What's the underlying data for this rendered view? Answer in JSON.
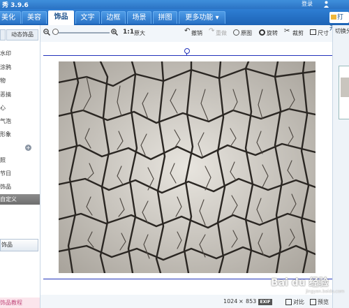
{
  "app": {
    "title": "秀 3.9.6",
    "login": "登录"
  },
  "tabs": [
    {
      "label": "美化",
      "active": false
    },
    {
      "label": "美容",
      "active": false
    },
    {
      "label": "饰品",
      "active": true
    },
    {
      "label": "文字",
      "active": false
    },
    {
      "label": "边框",
      "active": false
    },
    {
      "label": "场景",
      "active": false
    },
    {
      "label": "拼图",
      "active": false
    },
    {
      "label": "更多功能 ▾",
      "active": false
    }
  ],
  "open_button": "打开",
  "sidebar": {
    "dynamic_label": "动态饰品",
    "items": [
      "水印",
      "涂鸦",
      "物",
      "恶搞",
      "心",
      "气泡",
      "形象",
      "",
      "照",
      "节日",
      "饰品",
      "自定义"
    ],
    "selected_index": 11,
    "button_label": "饰品",
    "bottom_label": "饰品教程"
  },
  "toolbar": {
    "zoom_ratio": "1:1",
    "original_size": "原大",
    "undo": "撤销",
    "redo": "重做",
    "original_image": "原图",
    "rotate": "旋转",
    "crop": "裁剪",
    "size": "尺寸"
  },
  "right_panel": {
    "title": "切换分"
  },
  "status": {
    "width": "1024",
    "times": "×",
    "height": "853",
    "exif": "EXIF",
    "compare": "对比",
    "preview": "预览"
  },
  "watermark": {
    "text": "Bai du 经验",
    "sub": "jingyan.baidu.com"
  },
  "colors": {
    "accent": "#2b73c4",
    "guide": "#2233bb",
    "selected": "#7a7a7a"
  }
}
